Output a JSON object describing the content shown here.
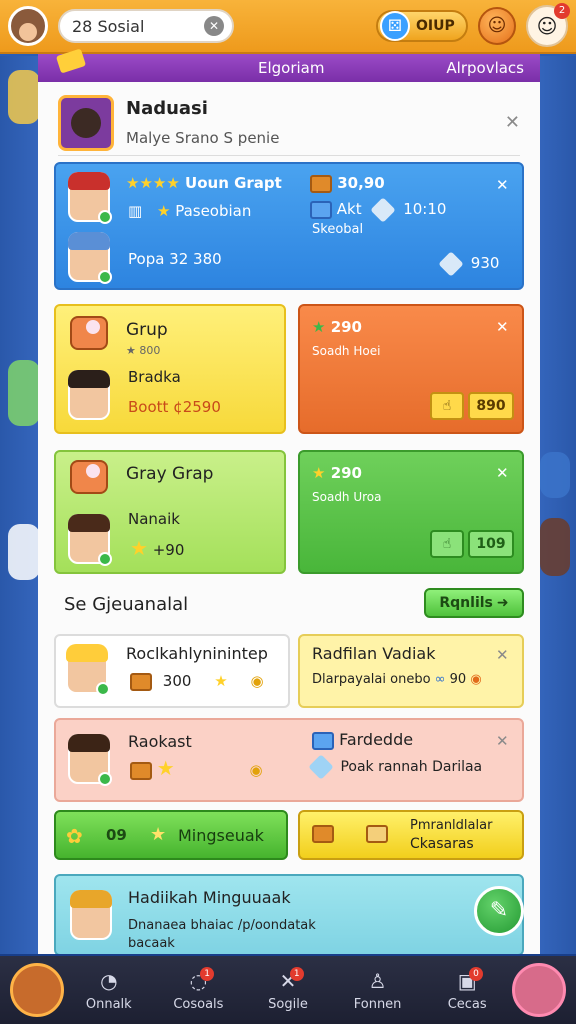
{
  "topbar": {
    "search_value": "28 Sosial",
    "currency_label": "OIUP",
    "notification_count": "2"
  },
  "strip": {
    "center": "Elgoriam",
    "right": "Alrpovlacs"
  },
  "notice": {
    "title": "Naduasi",
    "subtitle": "Malye Srano S penie"
  },
  "blue_card": {
    "title": "Uoun Grapt",
    "label2": "Paseobian",
    "label3": "Popa 32 380",
    "right1": "30,90",
    "right2": "Akt",
    "right2_value": "10:10",
    "right3": "Skeobal",
    "right4": "930"
  },
  "yellow_card": {
    "title": "Grup",
    "subtitle": "★ 800",
    "name": "Bradka",
    "value": "Boott ¢2590"
  },
  "orange_card": {
    "value": "290",
    "subtitle": "Soadh Hoei",
    "btn_value": "890"
  },
  "lime_card": {
    "title": "Gray Grap",
    "name": "Nanaik",
    "value": "+90"
  },
  "green_card": {
    "value": "290",
    "subtitle": "Soadh Uroa",
    "btn_value": "109"
  },
  "section": {
    "title": "Se Gjeuanalal",
    "button": "Rqnlils"
  },
  "white_card": {
    "title": "Roclkahlyninintep",
    "value": "300"
  },
  "lightyellow_card": {
    "title": "Radfilan Vadiak",
    "subtitle": "Dlarpayalai onebo",
    "value": "90"
  },
  "pink_card": {
    "title": "Raokast",
    "right_title": "Fardedde",
    "right_subtitle": "Poak rannah Darilaa"
  },
  "green_big": {
    "value": "09",
    "label": "Mingseuak"
  },
  "yellow_big": {
    "label1": "Pmranldlalar",
    "label2": "Ckasaras"
  },
  "cyan_card": {
    "title": "Hadiikah Minguuaak",
    "line2": "Dnanaea bhaiac /p/oondatak",
    "line3": "bacaak"
  },
  "nav": {
    "items": [
      {
        "label": "Onnalk",
        "badge": ""
      },
      {
        "label": "Cosoals",
        "badge": "1"
      },
      {
        "label": "Sogile",
        "badge": "1"
      },
      {
        "label": "Fonnen",
        "badge": ""
      },
      {
        "label": "Cecas",
        "badge": "0"
      }
    ]
  }
}
